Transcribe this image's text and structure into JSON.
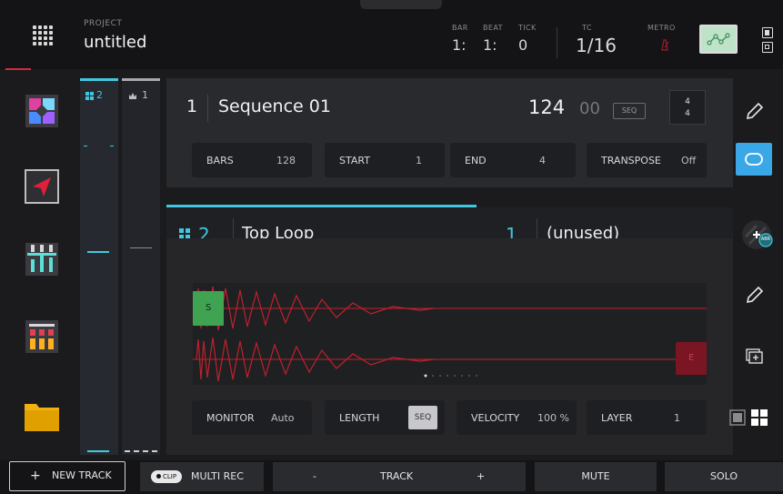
{
  "header": {
    "project_label": "PROJECT",
    "project_name": "untitled",
    "bar_label": "BAR",
    "bar_value": "1:",
    "beat_label": "BEAT",
    "beat_value": "1:",
    "tick_label": "TICK",
    "tick_value": "0",
    "tc_label": "TC",
    "tc_value": "1/16",
    "metro_label": "METRO"
  },
  "tracks": {
    "col_a_label": "2",
    "col_b_label": "1"
  },
  "sequence": {
    "number": "1",
    "name": "Sequence 01",
    "bpm": "124",
    "bpm_decimal": "00",
    "seq_tag": "SEQ",
    "sig_top": "4",
    "sig_bottom": "4",
    "fields": [
      {
        "label": "BARS",
        "value": "128"
      },
      {
        "label": "START",
        "value": "1"
      },
      {
        "label": "END",
        "value": "4"
      },
      {
        "label": "TRANSPOSE",
        "value": "Off"
      }
    ]
  },
  "tabs": {
    "active_num": "2",
    "active_name": "Top Loop",
    "other_num": "1",
    "other_name": "(unused)"
  },
  "wave": {
    "start_label": "S",
    "end_label": "E"
  },
  "params": [
    {
      "label": "MONITOR",
      "value": "Auto"
    },
    {
      "label": "LENGTH",
      "value": "SEQ"
    },
    {
      "label": "VELOCITY",
      "value": "100 %"
    },
    {
      "label": "LAYER",
      "value": "1"
    }
  ],
  "abr_badge": "ABR",
  "bottom": {
    "new_track": "NEW TRACK",
    "clip_tag": "CLIP",
    "multi_rec": "MULTI REC",
    "minus": "-",
    "track": "TRACK",
    "plus": "+",
    "mute": "MUTE",
    "solo": "SOLO"
  },
  "colors": {
    "accent": "#40c8e0",
    "waveform": "#c0202e",
    "start_marker": "#3fa352",
    "end_marker": "#7a1524",
    "active_blue": "#3aa8e6"
  }
}
